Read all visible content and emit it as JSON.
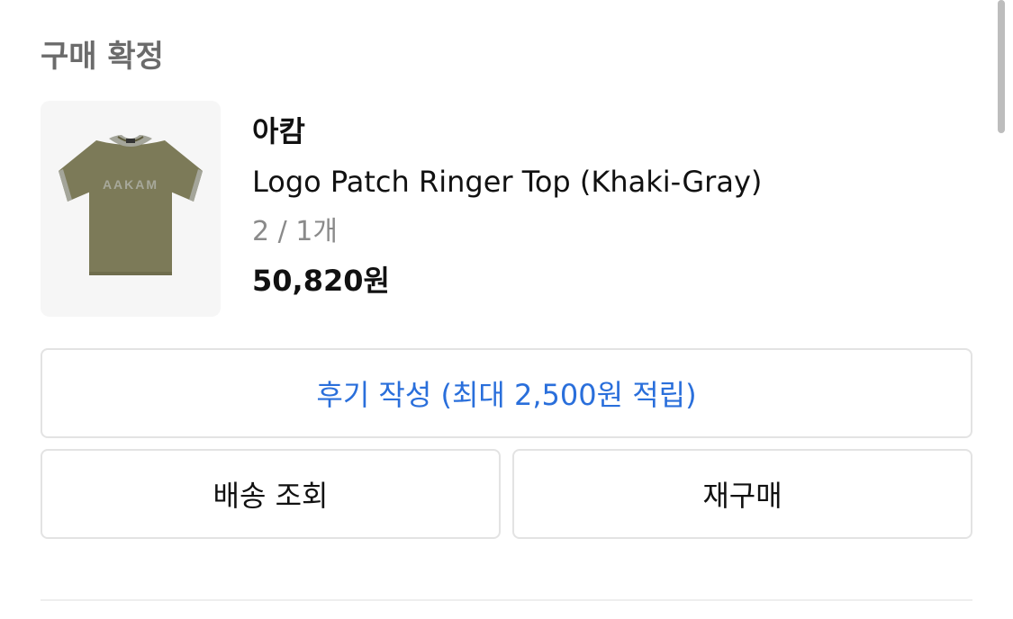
{
  "section": {
    "title": "구매 확정"
  },
  "product": {
    "brand": "아캄",
    "name": "Logo Patch Ringer Top (Khaki-Gray)",
    "option": "2 / 1개",
    "price": "50,820원",
    "image": {
      "alt": "Khaki ringer t-shirt",
      "logo_text": "AAKAM",
      "shirt_color": "#7c7a58",
      "trim_color": "#a4a59a"
    }
  },
  "actions": {
    "review_label": "후기 작성 (최대 2,500원 적립)",
    "shipping_label": "배송 조회",
    "rebuy_label": "재구매"
  },
  "colors": {
    "accent": "#2a6fdb",
    "secondary_text": "#8a8a8a",
    "border": "#e3e3e3"
  }
}
